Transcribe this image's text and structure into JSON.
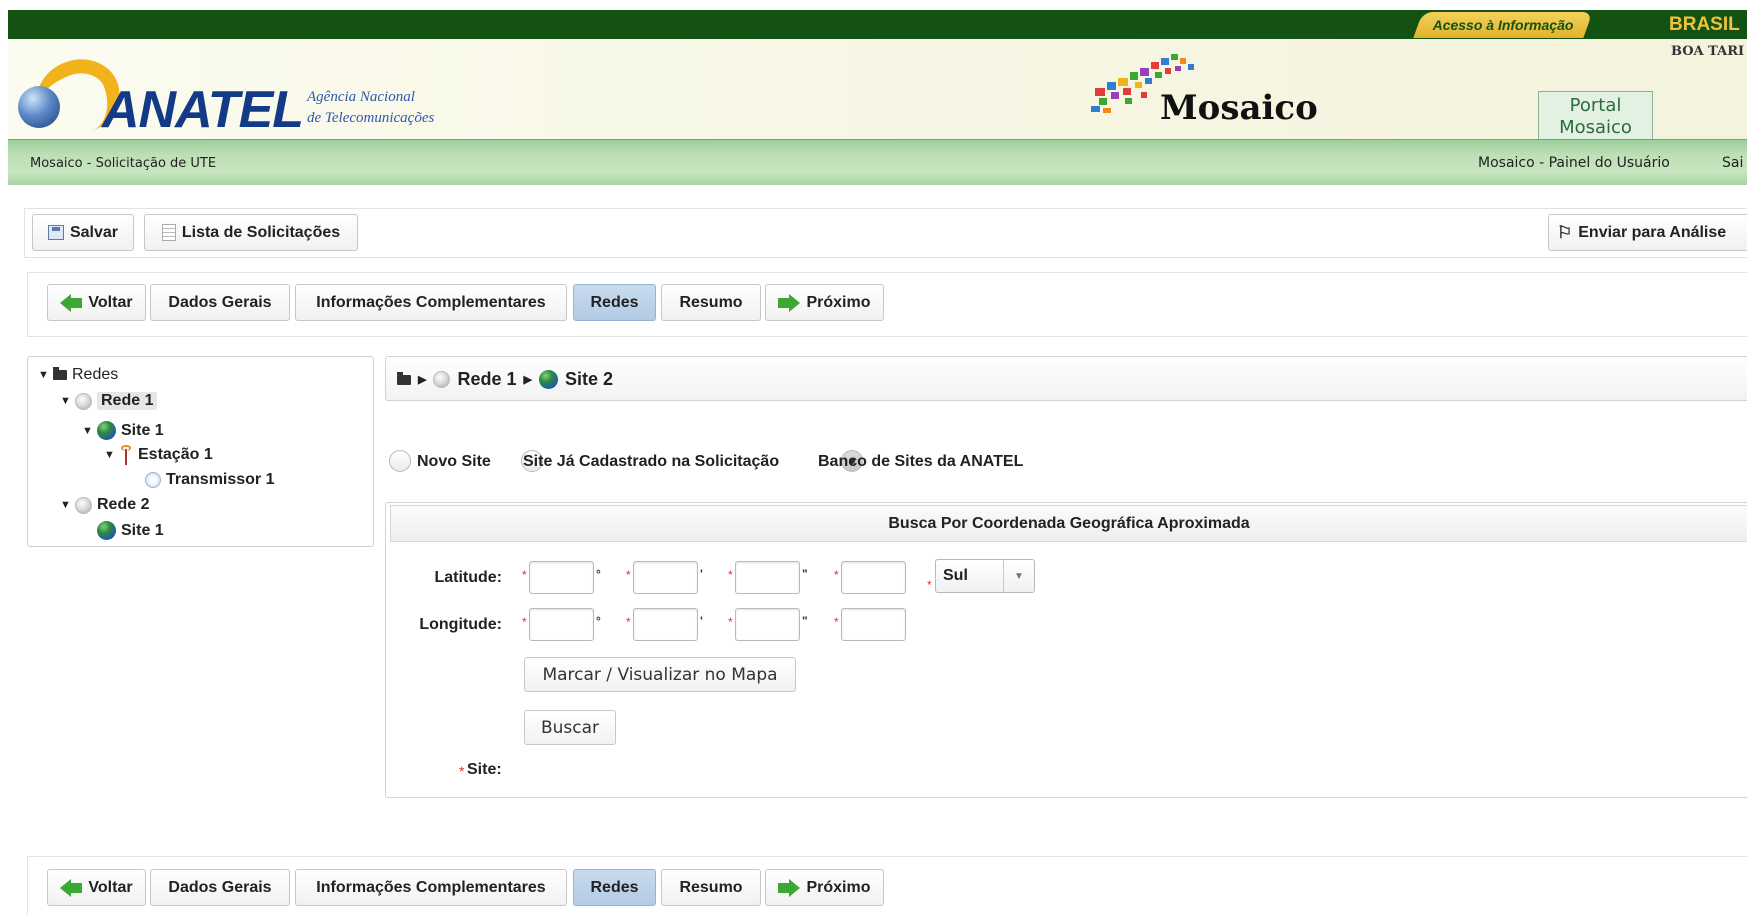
{
  "gov": {
    "acesso_label": "Acesso à Informação",
    "brasil_label": "BRASIL",
    "greeting": "BOA TARI"
  },
  "header": {
    "logo_text": "ANATEL",
    "agency_line1": "Agência Nacional",
    "agency_line2": "de Telecomunicações",
    "app_title": "Mosaico",
    "portal_line1": "Portal",
    "portal_line2": "Mosaico"
  },
  "strip": {
    "page_breadcrumb": "Mosaico - Solicitação de UTE",
    "user_panel": "Mosaico - Painel do Usuário",
    "logout": "Sai"
  },
  "toolbar": {
    "save_label": "Salvar",
    "list_label": "Lista de Solicitações",
    "send_label": "Enviar para Análise"
  },
  "nav": {
    "back_label": "Voltar",
    "tabs": [
      {
        "label": "Dados Gerais",
        "active": false
      },
      {
        "label": "Informações Complementares",
        "active": false
      },
      {
        "label": "Redes",
        "active": true
      },
      {
        "label": "Resumo",
        "active": false
      }
    ],
    "next_label": "Próximo"
  },
  "tree": {
    "root": "Redes",
    "nodes": [
      {
        "label": "Rede 1",
        "type": "network",
        "selected": true
      },
      {
        "label": "Site 1",
        "type": "site"
      },
      {
        "label": "Estação 1",
        "type": "station"
      },
      {
        "label": "Transmissor 1",
        "type": "transmitter"
      },
      {
        "label": "Rede 2",
        "type": "network"
      },
      {
        "label": "Site 1",
        "type": "site"
      }
    ]
  },
  "breadcrumb": {
    "network": "Rede 1",
    "site": "Site 2"
  },
  "site_source": {
    "options": [
      "Novo Site",
      "Site Já Cadastrado na Solicitação",
      "Banco de Sites da ANATEL"
    ],
    "selected": "Banco de Sites da ANATEL"
  },
  "search": {
    "title": "Busca Por Coordenada Geográfica Aproximada",
    "latitude_label": "Latitude:",
    "longitude_label": "Longitude:",
    "degree_unit": "°",
    "minute_unit": "'",
    "second_unit": "\"",
    "hemisphere_value": "Sul",
    "map_button": "Marcar / Visualizar no Mapa",
    "search_button": "Buscar",
    "site_label": "Site:",
    "required_mark": "*"
  },
  "colors": {
    "gov_green": "#145214",
    "anatel_blue": "#133a86",
    "active_tab": "#c9dbee",
    "required": "#d33333"
  }
}
